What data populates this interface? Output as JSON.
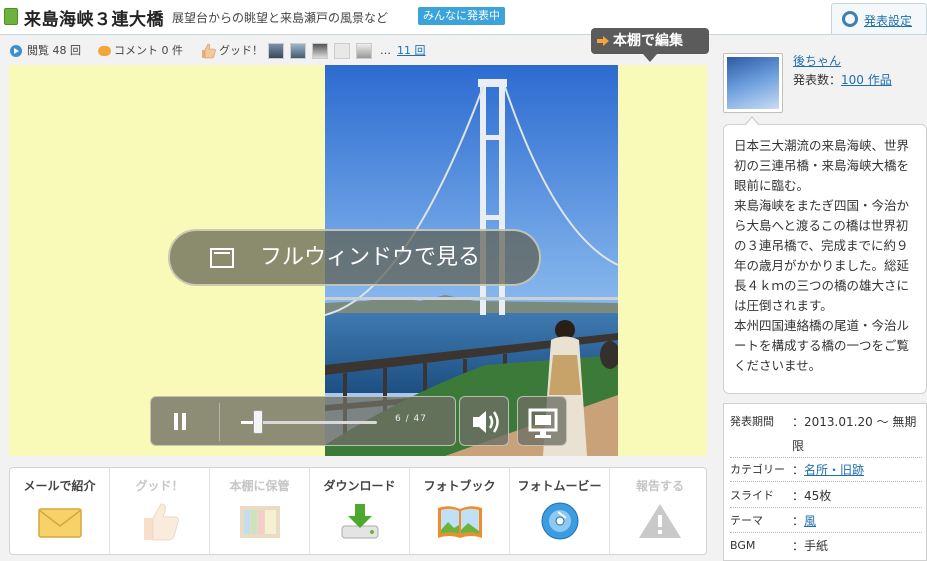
{
  "header": {
    "title": "来島海峡３連大橋",
    "subtitle": "展望台からの眺望と来島瀬戸の風景など",
    "badge": "みんなに発表中",
    "settings_label": "発表設定"
  },
  "stats": {
    "views": "閲覧 48 回",
    "comments": "コメント 0 件",
    "good": "グッド！",
    "ellipsis": "…",
    "more": "11 回"
  },
  "edit_button": "本棚で編集",
  "viewer": {
    "fullwindow_label": "フルウィンドウで見る",
    "slide_counter": "6 / 47",
    "progress_fraction": 0.128
  },
  "actions": [
    {
      "label": "メールで紹介",
      "icon": "envelope-icon",
      "enabled": true
    },
    {
      "label": "グッド！",
      "icon": "thumbs-up-icon",
      "enabled": false
    },
    {
      "label": "本棚に保管",
      "icon": "bookshelf-icon",
      "enabled": false
    },
    {
      "label": "ダウンロード",
      "icon": "download-icon",
      "enabled": true
    },
    {
      "label": "フォトブック",
      "icon": "photobook-icon",
      "enabled": true
    },
    {
      "label": "フォトムービー",
      "icon": "disc-icon",
      "enabled": true
    },
    {
      "label": "報告する",
      "icon": "warning-icon",
      "enabled": false
    }
  ],
  "author": {
    "name": "後ちゃん",
    "works_label": "発表数：",
    "works_link": "100 作品"
  },
  "description": "日本三大潮流の来島海峡、世界初の三連吊橋・来島海峡大橋を眼前に臨む。\n来島海峡をまたぎ四国・今治から大島へと渡るこの橋は世界初の３連吊橋で、完成までに約９年の歳月がかかりました。総延長４ｋｍの三つの橋の雄大さには圧倒されます。\n本州四国連絡橋の尾道・今治ルートを構成する橋の一つをご覧くださいませ。",
  "info": [
    {
      "key": "発表期間",
      "value": "：2013.01.20 ～ 無期限",
      "link": ""
    },
    {
      "key": "カテゴリー",
      "value": "：",
      "link": "名所・旧跡"
    },
    {
      "key": "スライド",
      "value": "：45枚",
      "link": ""
    },
    {
      "key": "テーマ",
      "value": "：",
      "link": "風"
    },
    {
      "key": "BGM",
      "value": "：手紙",
      "link": ""
    }
  ],
  "colors": {
    "accent": "#3aa3d9",
    "link": "#1f6fb0",
    "viewer_bg": "#fafab8"
  }
}
